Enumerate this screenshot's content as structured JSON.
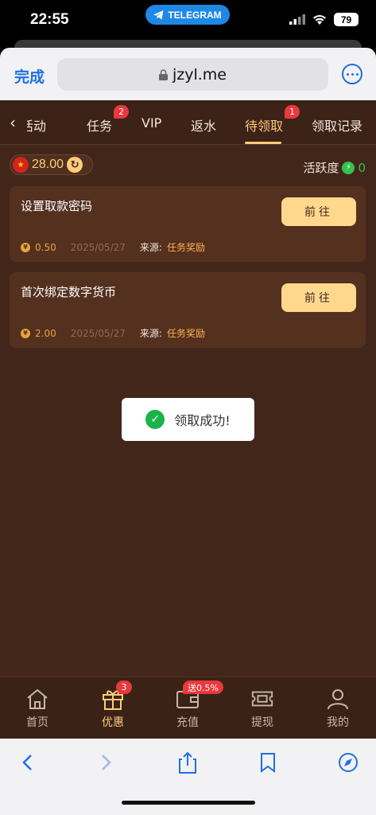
{
  "status_bar": {
    "time": "22:55",
    "telegram_label": "TELEGRAM",
    "battery": "79"
  },
  "browser": {
    "done_label": "完成",
    "url": "jzyl.me"
  },
  "tabs": {
    "items": [
      {
        "label": "活动"
      },
      {
        "label": "任务",
        "badge": "2"
      },
      {
        "label": "VIP"
      },
      {
        "label": "返水"
      },
      {
        "label": "待领取",
        "badge": "1",
        "active": true
      },
      {
        "label": "领取记录"
      }
    ]
  },
  "balance": {
    "amount": "28.00"
  },
  "activity": {
    "label": "活跃度",
    "value": "0"
  },
  "rewards": [
    {
      "title": "设置取款密码",
      "button": "前往",
      "amount": "0.50",
      "date": "2025/05/27",
      "source_label": "来源:",
      "source": "任务奖励"
    },
    {
      "title": "首次绑定数字货币",
      "button": "前往",
      "amount": "2.00",
      "date": "2025/05/27",
      "source_label": "来源:",
      "source": "任务奖励"
    }
  ],
  "toast": {
    "message": "领取成功!"
  },
  "bottom_nav": {
    "items": [
      {
        "label": "首页"
      },
      {
        "label": "优惠",
        "badge": "3",
        "active": true
      },
      {
        "label": "充值",
        "promo": "送0.5%"
      },
      {
        "label": "提现"
      },
      {
        "label": "我的"
      }
    ]
  },
  "colors": {
    "accent": "#ffcc7a",
    "background": "#42261a",
    "card": "#54301f",
    "badge": "#e8393e",
    "success": "#19b34a",
    "ios_blue": "#1f6fe0"
  }
}
